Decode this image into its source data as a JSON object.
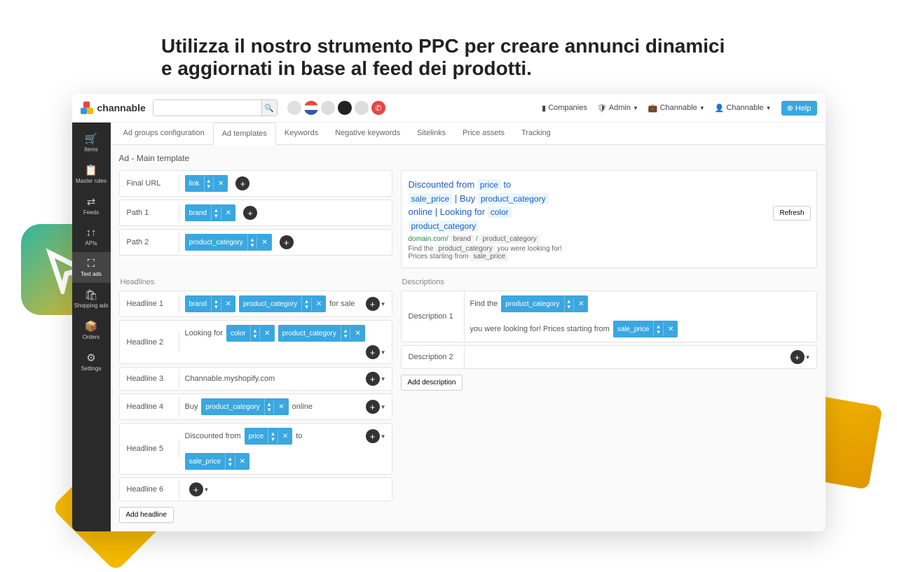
{
  "hero": {
    "title": "Utilizza il nostro strumento PPC per creare annunci dinamici e aggiornati in base al feed dei prodotti."
  },
  "topbar": {
    "brand": "channable",
    "companies": "Companies",
    "admin": "Admin",
    "org": "Channable",
    "user": "Channable",
    "help": "Help"
  },
  "sidebar": {
    "items": [
      {
        "icon": "🛒",
        "label": "Items"
      },
      {
        "icon": "📋",
        "label": "Master rules"
      },
      {
        "icon": "⇄",
        "label": "Feeds"
      },
      {
        "icon": "↕↑",
        "label": "APIs"
      },
      {
        "icon": "⛶",
        "label": "Text ads",
        "active": true
      },
      {
        "icon": "🛍",
        "label": "Shopping ads"
      },
      {
        "icon": "📦",
        "label": "Orders"
      },
      {
        "icon": "⚙",
        "label": "Settings"
      }
    ]
  },
  "tabs": [
    {
      "label": "Ad groups configuration"
    },
    {
      "label": "Ad templates",
      "active": true
    },
    {
      "label": "Keywords"
    },
    {
      "label": "Negative keywords"
    },
    {
      "label": "Sitelinks"
    },
    {
      "label": "Price assets"
    },
    {
      "label": "Tracking"
    }
  ],
  "sectionTitle": "Ad - Main template",
  "urlRows": [
    {
      "label": "Final URL",
      "tag": "link"
    },
    {
      "label": "Path 1",
      "tag": "brand"
    },
    {
      "label": "Path 2",
      "tag": "product_category"
    }
  ],
  "preview": {
    "refresh": "Refresh",
    "title_parts": {
      "t1": "Discounted from",
      "v1": "price",
      "t2": "to",
      "v2": "sale_price",
      "t3": "| Buy",
      "v3": "product_category",
      "t4": "online | Looking for",
      "v4": "color",
      "v5": "product_category"
    },
    "url": {
      "domain": "domain.com/",
      "p1": "brand",
      "sep": "/",
      "p2": "product_category"
    },
    "desc": {
      "d1a": "Find the",
      "d1v": "product_category",
      "d1b": "you were looking for!",
      "d2a": "Prices starting from",
      "d2v": "sale_price"
    }
  },
  "headlinesTitle": "Headlines",
  "headlines": {
    "h1_label": "Headline 1",
    "h1_tag1": "brand",
    "h1_tag2": "product_category",
    "h1_txt": "for sale",
    "h2_label": "Headline 2",
    "h2_txt1": "Looking for",
    "h2_tag1": "color",
    "h2_tag2": "product_category",
    "h3_label": "Headline 3",
    "h3_txt": "Channable.myshopify.com",
    "h4_label": "Headline 4",
    "h4_txt1": "Buy",
    "h4_tag": "product_category",
    "h4_txt2": "online",
    "h5_label": "Headline 5",
    "h5_txt1": "Discounted from",
    "h5_tag1": "price",
    "h5_txt2": "to",
    "h5_tag2": "sale_price",
    "h6_label": "Headline 6",
    "addBtn": "Add headline"
  },
  "descTitle": "Descriptions",
  "descriptions": {
    "d1_label": "Description 1",
    "d1_txt1": "Find the",
    "d1_tag1": "product_category",
    "d1_txt2": "you were looking for! Prices starting from",
    "d1_tag2": "sale_price",
    "d2_label": "Description 2",
    "addBtn": "Add description"
  }
}
